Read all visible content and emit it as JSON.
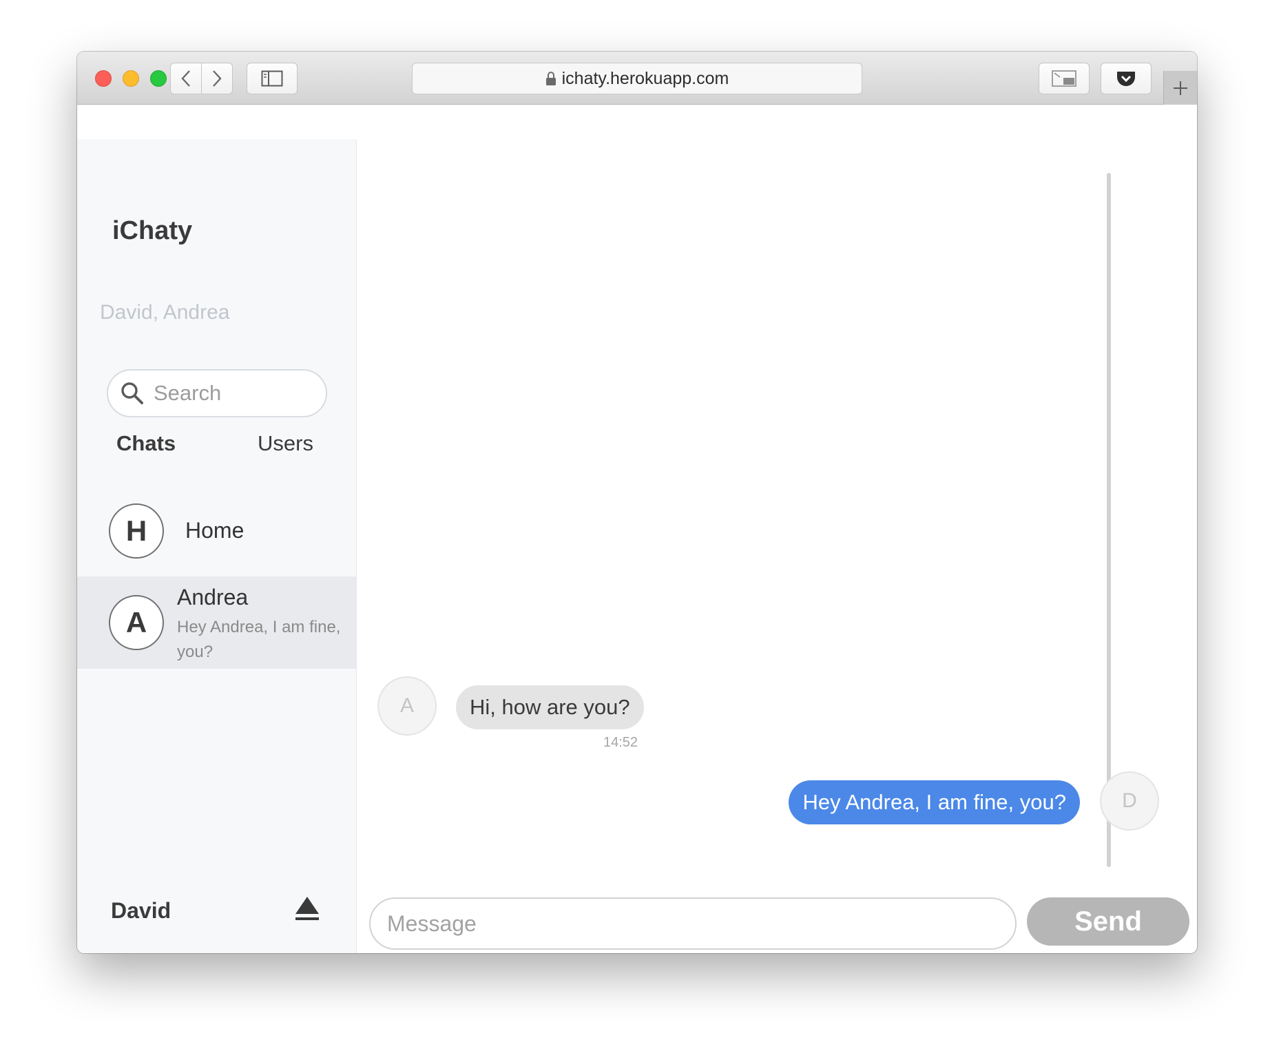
{
  "browser": {
    "url": "ichaty.herokuapp.com"
  },
  "sidebar": {
    "app_title": "iChaty",
    "members": "David, Andrea",
    "search_placeholder": "Search",
    "tabs": [
      {
        "label": "Chats",
        "active": true
      },
      {
        "label": "Users",
        "active": false
      }
    ],
    "chats": [
      {
        "initial": "H",
        "name": "Home",
        "preview": "",
        "active": false
      },
      {
        "initial": "A",
        "name": "Andrea",
        "preview": "Hey Andrea, I am fine, you?",
        "active": true
      }
    ],
    "current_user": "David"
  },
  "conversation": {
    "messages": [
      {
        "sender_initial": "A",
        "text": "Hi, how are you?",
        "time": "14:52",
        "direction": "incoming"
      },
      {
        "sender_initial": "D",
        "text": "Hey Andrea, I am fine, you?",
        "time": "",
        "direction": "outgoing"
      }
    ]
  },
  "composer": {
    "placeholder": "Message",
    "send_label": "Send"
  },
  "colors": {
    "outgoing_bubble": "#4b88e8",
    "incoming_bubble": "#e4e4e4",
    "send_button": "#b6b6b6",
    "sidebar_bg": "#f7f8fa",
    "active_chat_bg": "#e8eaed"
  },
  "icons": {
    "search": "search-icon",
    "logout": "eject-icon",
    "lock": "lock-icon"
  }
}
